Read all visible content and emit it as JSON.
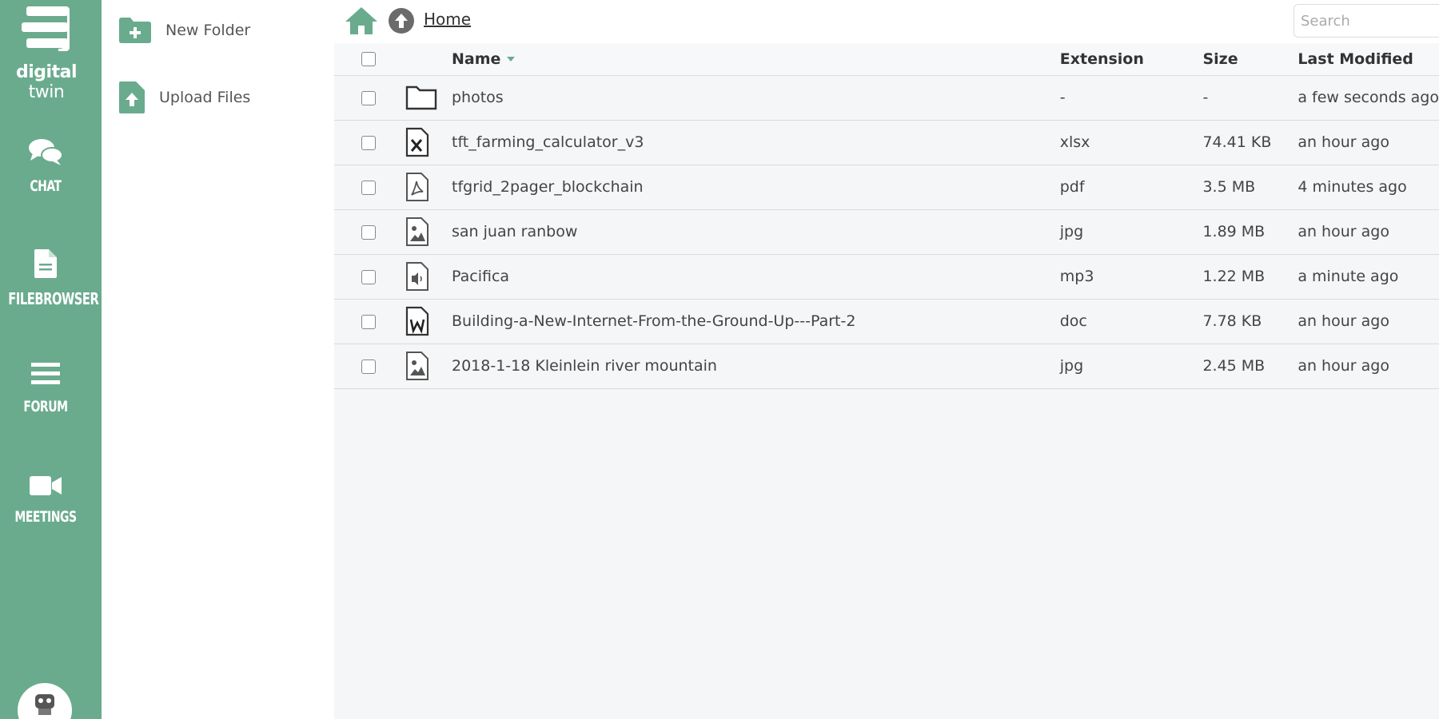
{
  "brand": {
    "logo_text_bold": "digital",
    "logo_text_regular": " twin",
    "accent": "#6aab8e"
  },
  "nav": {
    "items": [
      {
        "label": "CHAT",
        "icon": "chat-icon"
      },
      {
        "label": "FILEBROWSER",
        "icon": "file-icon",
        "active": true
      },
      {
        "label": "FORUM",
        "icon": "forum-icon"
      },
      {
        "label": "MEETINGS",
        "icon": "video-camera-icon"
      }
    ]
  },
  "actions": {
    "new_folder": "New Folder",
    "upload_files": "Upload Files"
  },
  "breadcrumb": {
    "home": "Home"
  },
  "search": {
    "placeholder": "Search"
  },
  "table": {
    "headers": {
      "name": "Name",
      "extension": "Extension",
      "size": "Size",
      "last_modified": "Last Modified"
    },
    "rows": [
      {
        "icon": "folder-icon",
        "name": "photos",
        "extension": "-",
        "size": "-",
        "modified": "a few seconds ago"
      },
      {
        "icon": "excel-file-icon",
        "name": "tft_farming_calculator_v3",
        "extension": "xlsx",
        "size": "74.41 KB",
        "modified": "an hour ago"
      },
      {
        "icon": "pdf-file-icon",
        "name": "tfgrid_2pager_blockchain",
        "extension": "pdf",
        "size": "3.5 MB",
        "modified": "4 minutes ago"
      },
      {
        "icon": "image-file-icon",
        "name": "san juan ranbow",
        "extension": "jpg",
        "size": "1.89 MB",
        "modified": "an hour ago"
      },
      {
        "icon": "audio-file-icon",
        "name": "Pacifica",
        "extension": "mp3",
        "size": "1.22 MB",
        "modified": "a minute ago"
      },
      {
        "icon": "word-file-icon",
        "name": "Building-a-New-Internet-From-the-Ground-Up---Part-2",
        "extension": "doc",
        "size": "7.78 KB",
        "modified": "an hour ago"
      },
      {
        "icon": "image-file-icon",
        "name": "2018-1-18 Kleinlein river mountain",
        "extension": "jpg",
        "size": "2.45 MB",
        "modified": "an hour ago"
      }
    ]
  }
}
